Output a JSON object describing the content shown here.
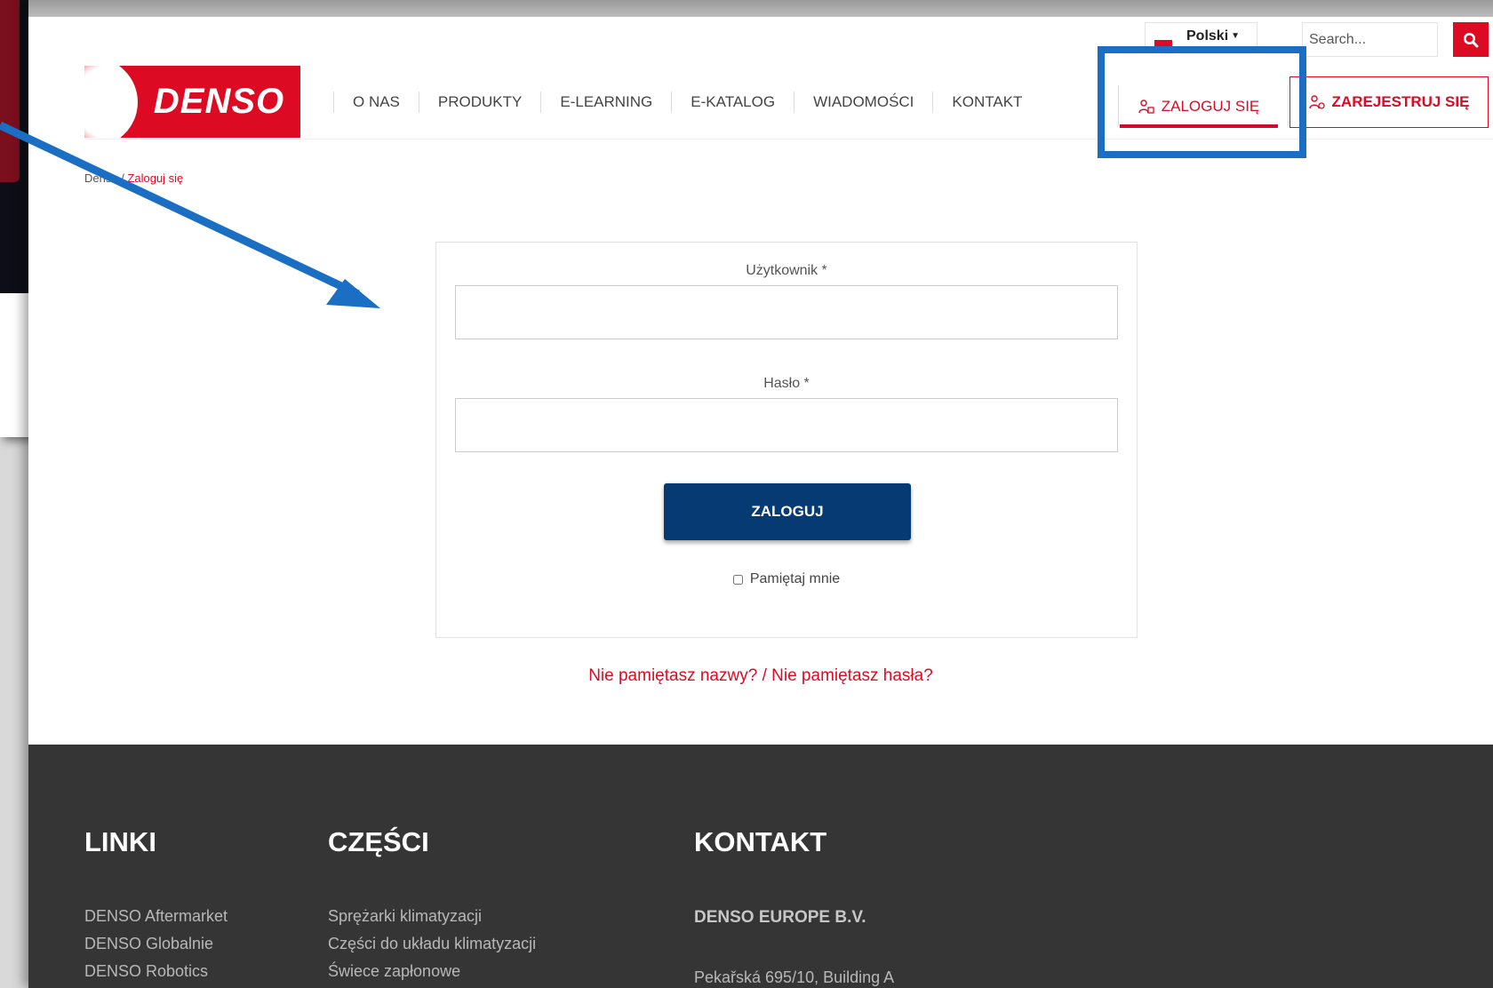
{
  "header": {
    "logo_text": "DENSO",
    "nav": [
      "O NAS",
      "PRODUKTY",
      "E-LEARNING",
      "E-KATALOG",
      "WIADOMOŚCI",
      "KONTAKT"
    ],
    "language": "Polski",
    "search_placeholder": "Search...",
    "login_label": "ZALOGUJ SIĘ",
    "register_label": "ZAREJESTRUJ SIĘ"
  },
  "breadcrumb": {
    "home": "Denso",
    "separator": " / ",
    "current": "Zaloguj się"
  },
  "form": {
    "username_label": "Użytkownik *",
    "password_label": "Hasło *",
    "submit_label": "ZALOGUJ",
    "remember_label": "Pamiętaj mnie"
  },
  "forgot": {
    "username": "Nie pamiętasz nazwy?",
    "separator": " / ",
    "password": "Nie pamiętasz hasła?"
  },
  "footer": {
    "links_heading": "LINKI",
    "links": [
      "DENSO Aftermarket",
      "DENSO Globalnie",
      "DENSO Robotics"
    ],
    "parts_heading": "CZĘŚCI",
    "parts": [
      "Sprężarki klimatyzacji",
      "Części do układu klimatyzacji",
      "Świece zapłonowe"
    ],
    "contact_heading": "KONTAKT",
    "contact_company": "DENSO EUROPE B.V.",
    "contact_address": "Pekařská 695/10, Building A"
  },
  "colors": {
    "brand_red": "#dc0b23",
    "button_navy": "#063a72",
    "annotation_blue": "#1a6ec3",
    "footer_bg": "#353535"
  }
}
